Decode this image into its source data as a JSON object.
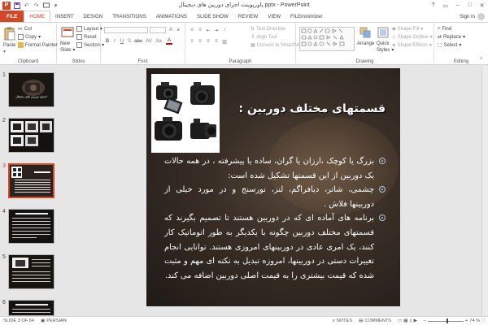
{
  "titlebar": {
    "app_badge": "P",
    "title": "پاورپوینت اجزای دوربین های دیجیتال.pptx - PowerPoint",
    "qat_icons": [
      "save-icon",
      "undo-icon",
      "redo-icon",
      "slideshow-icon"
    ],
    "window_controls": [
      "?",
      "▭",
      "–",
      "□",
      "✕"
    ]
  },
  "tabs": [
    "FILE",
    "HOME",
    "INSERT",
    "DESIGN",
    "TRANSITIONS",
    "ANIMATIONS",
    "SLIDE SHOW",
    "REVIEW",
    "VIEW",
    "FILEminimizer"
  ],
  "active_tab": "HOME",
  "signin": "Sign in",
  "ribbon": {
    "clipboard": {
      "label": "Clipboard",
      "paste": "Paste",
      "cut": "Cut",
      "copy": "Copy",
      "format_painter": "Format Painter"
    },
    "slides": {
      "label": "Slides",
      "new_slide": "New",
      "new_slide_2": "Slide",
      "layout": "Layout",
      "reset": "Reset",
      "section": "Section"
    },
    "font": {
      "label": "Font",
      "formats": [
        "B",
        "I",
        "U",
        "S",
        "abc",
        "AV",
        "Aa",
        "A"
      ]
    },
    "paragraph": {
      "label": "Paragraph",
      "text_direction": "Text Direction",
      "align_text": "Align Text",
      "convert_smartart": "Convert to SmartArt"
    },
    "drawing": {
      "label": "Drawing",
      "arrange": "Arrange",
      "quick_styles": "Quick",
      "quick_styles_2": "Styles",
      "shape_fill": "Shape Fill",
      "shape_outline": "Shape Outline",
      "shape_effects": "Shape Effects"
    },
    "editing": {
      "label": "Editing",
      "find": "Find",
      "replace": "Replace",
      "select": "Select"
    }
  },
  "thumbnails": [
    {
      "num": "1",
      "caption": "اجزای دوربین های دیجیتال"
    },
    {
      "num": "2"
    },
    {
      "num": "3"
    },
    {
      "num": "4"
    },
    {
      "num": "5"
    },
    {
      "num": "6"
    }
  ],
  "slide": {
    "title": "قسمتهای مختلف دوربین :",
    "bullets": [
      "بزرگ یا کوچک ،ارزان یا گران، ساده یا پیشرفته ، در همه حالات یک دوربین از این قسمتها تشکیل شده است:",
      "چشمی، شاتر، دیافراگم، لنز، نورسنج و در مورد خیلی از دوربینها فلاش .",
      "برنامه های آماده ای که در دوربین هستند تا تصمیم بگیرند که قسمتهای مختلف دوربین چگونه با یکدیگر به طور اتوماتیک کار کنند، یک امری عادی در دوربینهای امروزی هستند. توانایی انجام تغییرات دستی در دوربینها، امروزه تبدیل به نکته ای مهم و مثبت شده که قیمت بیشتری را به قیمت اصلی دوربین اضافه می کند."
    ]
  },
  "status": {
    "slide_of": "SLIDE 3 OF 64",
    "language": "PERSIAN",
    "notes": "NOTES",
    "comments": "COMMENTS",
    "zoom_level": "74 %",
    "zoom_fraction": 0.55
  },
  "colors": {
    "accent": "#d24726",
    "slide_bg": "#2e2620"
  }
}
